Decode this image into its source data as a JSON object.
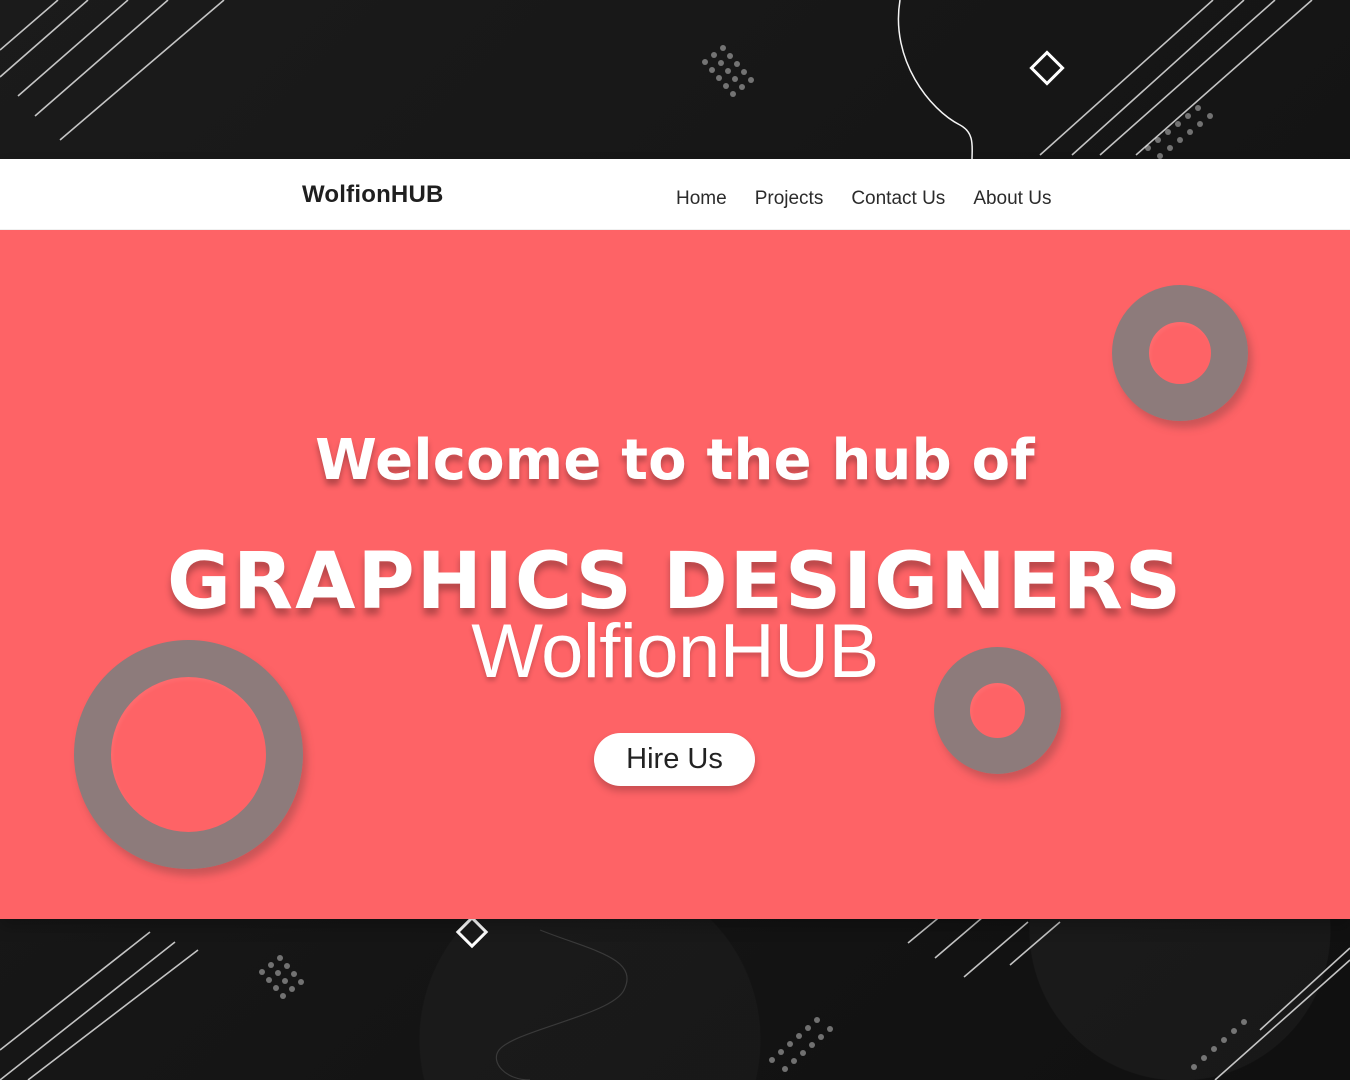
{
  "navbar": {
    "brand": "WolfionHUB",
    "links": [
      {
        "label": "Home"
      },
      {
        "label": "Projects"
      },
      {
        "label": "Contact Us"
      },
      {
        "label": "About Us"
      }
    ]
  },
  "hero": {
    "headline_line_1": "Welcome to the hub of",
    "headline_line_2": "GRAPHICS DESIGNERS",
    "brand_name": "WolfionHUB",
    "cta_label": "Hire Us"
  },
  "colors": {
    "hero_background": "#fe6366",
    "ring_color": "#8d7b7b",
    "navbar_background": "#ffffff",
    "outer_background": "#151515"
  }
}
